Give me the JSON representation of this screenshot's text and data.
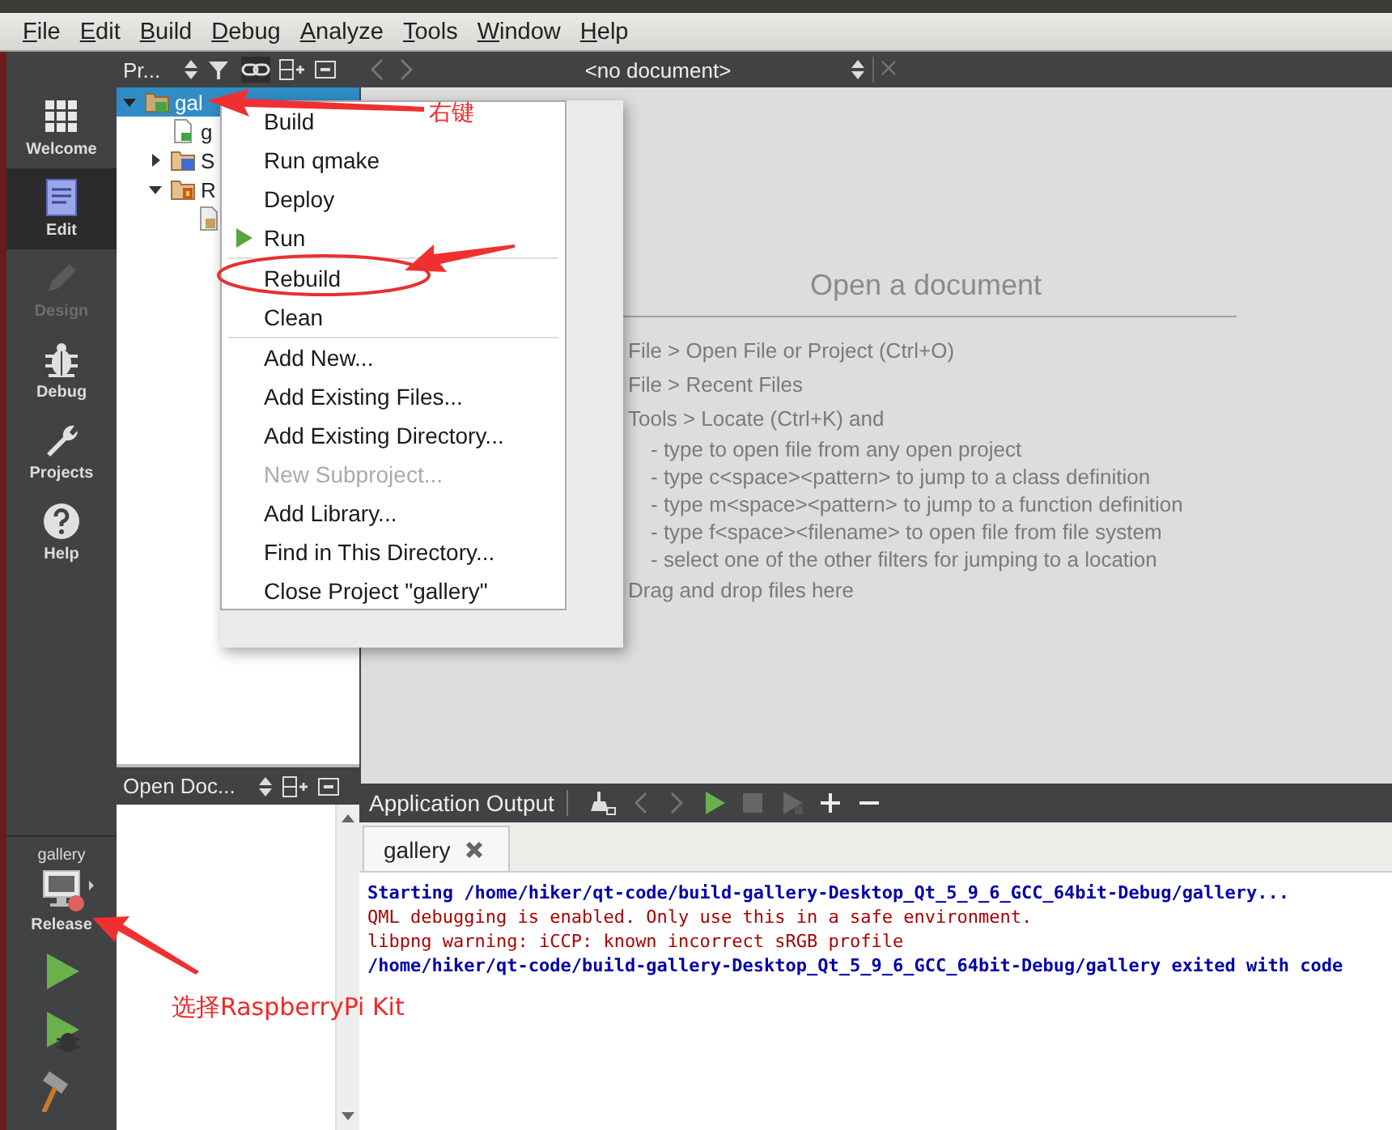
{
  "menubar": [
    {
      "label": "File"
    },
    {
      "label": "Edit"
    },
    {
      "label": "Build"
    },
    {
      "label": "Debug"
    },
    {
      "label": "Analyze"
    },
    {
      "label": "Tools"
    },
    {
      "label": "Window"
    },
    {
      "label": "Help"
    }
  ],
  "toolbar": {
    "project_view": "Pr...",
    "document": "<no document>"
  },
  "modes": [
    {
      "label": "Welcome",
      "kind": "welcome",
      "selected": false,
      "disabled": false
    },
    {
      "label": "Edit",
      "kind": "edit",
      "selected": true,
      "disabled": false
    },
    {
      "label": "Design",
      "kind": "design",
      "selected": false,
      "disabled": true
    },
    {
      "label": "Debug",
      "kind": "debug",
      "selected": false,
      "disabled": false
    },
    {
      "label": "Projects",
      "kind": "projects",
      "selected": false,
      "disabled": false
    },
    {
      "label": "Help",
      "kind": "help",
      "selected": false,
      "disabled": false
    }
  ],
  "kit": {
    "project": "gallery",
    "build": "Release"
  },
  "project_tree": [
    {
      "label": "gal",
      "kind": "project",
      "selected": true,
      "expanded": true,
      "children": [
        {
          "label": "g",
          "kind": "pro",
          "selected": false
        },
        {
          "label": "S",
          "kind": "sources",
          "selected": false,
          "expanded": false
        },
        {
          "label": "R",
          "kind": "resources",
          "selected": false,
          "expanded": true,
          "children": [
            {
              "kind": "qrc",
              "selected": false
            }
          ]
        }
      ]
    }
  ],
  "context_menu": [
    {
      "kind": "item",
      "label": "Build",
      "disabled": false
    },
    {
      "kind": "item",
      "label": "Run qmake",
      "disabled": false
    },
    {
      "kind": "item",
      "label": "Deploy",
      "disabled": false
    },
    {
      "kind": "run",
      "label": "Run",
      "disabled": false
    },
    {
      "kind": "separator"
    },
    {
      "kind": "item",
      "label": "Rebuild",
      "disabled": false
    },
    {
      "kind": "item",
      "label": "Clean",
      "disabled": false
    },
    {
      "kind": "separator"
    },
    {
      "kind": "item",
      "label": "Add New...",
      "disabled": false
    },
    {
      "kind": "item",
      "label": "Add Existing Files...",
      "disabled": false
    },
    {
      "kind": "item",
      "label": "Add Existing Directory...",
      "disabled": false
    },
    {
      "kind": "item",
      "label": "New Subproject...",
      "disabled": true
    },
    {
      "kind": "item",
      "label": "Add Library...",
      "disabled": false
    },
    {
      "kind": "item",
      "label": "Find in This Directory...",
      "disabled": false
    },
    {
      "kind": "item",
      "label": "Close Project \"gallery\"",
      "disabled": false
    }
  ],
  "editor": {
    "title": "Open a document",
    "hints": [
      {
        "text": "File > Open File or Project (Ctrl+O)"
      },
      {
        "text": "File > Recent Files"
      },
      {
        "text": "Tools > Locate (Ctrl+K) and",
        "children": [
          {
            "text": "- type to open file from any open project"
          },
          {
            "text": "- type c<space><pattern> to jump to a class definition"
          },
          {
            "text": "- type m<space><pattern> to jump to a function definition"
          },
          {
            "text": "- type f<space><filename> to open file from file system"
          },
          {
            "text": "- select one of the other filters for jumping to a location"
          }
        ]
      },
      {
        "text": "Drag and drop files here"
      }
    ]
  },
  "open_documents": {
    "title": "Open Doc..."
  },
  "output": {
    "title": "Application Output",
    "tabs": [
      {
        "label": "gallery",
        "selected": true
      }
    ],
    "lines": [
      {
        "kind": "info",
        "text": "Starting /home/hiker/qt-code/build-gallery-Desktop_Qt_5_9_6_GCC_64bit-Debug/gallery..."
      },
      {
        "kind": "error",
        "text": "QML debugging is enabled. Only use this in a safe environment."
      },
      {
        "kind": "error",
        "text": "libpng warning: iCCP: known incorrect sRGB profile"
      },
      {
        "kind": "info",
        "text": "/home/hiker/qt-code/build-gallery-Desktop_Qt_5_9_6_GCC_64bit-Debug/gallery exited with code"
      }
    ]
  },
  "annotations": [
    {
      "kind": "label",
      "text": "右键"
    },
    {
      "kind": "label",
      "text": "选择RaspberryPi Kit"
    }
  ]
}
